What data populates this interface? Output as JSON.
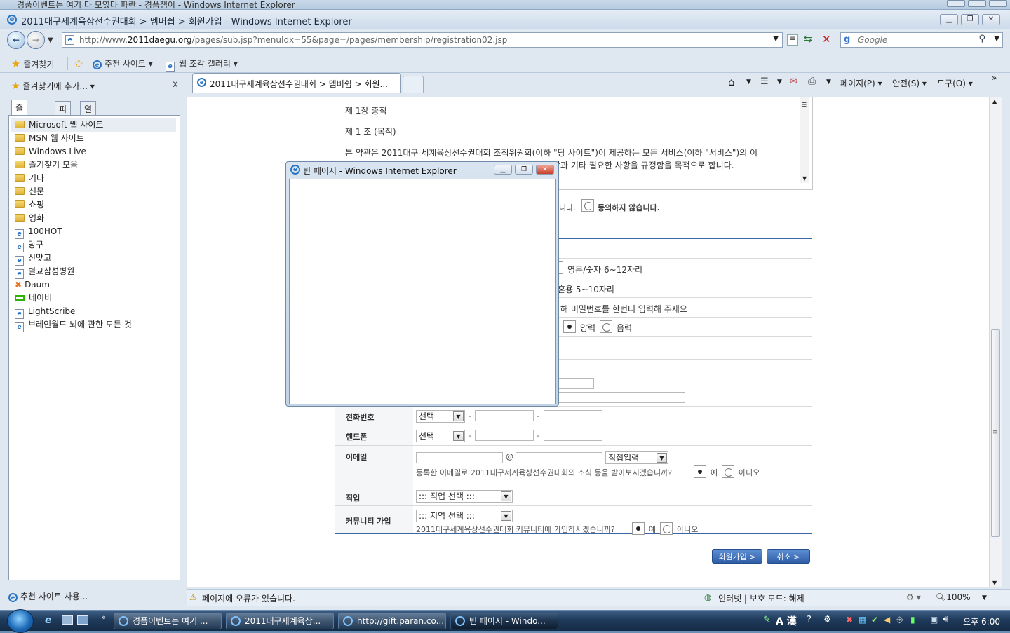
{
  "background_window": {
    "title": "경품이벤트는 여기 다 모였다 파란 - 경품잼이 - Windows Internet Explorer"
  },
  "window": {
    "title": "2011대구세계육상선수권대회 > 멤버쉽 > 회원가입 - Windows Internet Explorer",
    "address_prefix": "http://www.",
    "address_domain": "2011daegu.org",
    "address_path": "/pages/sub.jsp?menuIdx=55&page=/pages/membership/registration02.jsp",
    "search_placeholder": "Google"
  },
  "favorites_bar": {
    "favorites_label": "즐겨찾기",
    "suggested_sites": "추천 사이트",
    "web_slice_gallery": "웹 조각 갤러리"
  },
  "tab": {
    "title": "2011대구세계육상선수권대회 > 멤버쉽 > 회원..."
  },
  "command_bar": {
    "page": "페이지(P)",
    "safety": "안전(S)",
    "tools": "도구(O)",
    "chevron": "»"
  },
  "favorites_pane": {
    "add_label": "즐겨찾기에 추가...",
    "close": "x",
    "tabs": [
      "즐겨찾기",
      "피드",
      "열어본 페이지 목록"
    ],
    "items": [
      {
        "label": "Microsoft 웹 사이트",
        "kind": "folder"
      },
      {
        "label": "MSN 웹 사이트",
        "kind": "folder"
      },
      {
        "label": "Windows Live",
        "kind": "folder"
      },
      {
        "label": "즐겨찾기 모음",
        "kind": "folder"
      },
      {
        "label": "기타",
        "kind": "folder"
      },
      {
        "label": "신문",
        "kind": "folder"
      },
      {
        "label": "쇼핑",
        "kind": "folder"
      },
      {
        "label": "영화",
        "kind": "folder"
      },
      {
        "label": "100HOT",
        "kind": "page"
      },
      {
        "label": "당구",
        "kind": "page"
      },
      {
        "label": "신맞고",
        "kind": "page"
      },
      {
        "label": "별교삼성병원",
        "kind": "page"
      },
      {
        "label": "Daum",
        "kind": "daum"
      },
      {
        "label": "네이버",
        "kind": "naver"
      },
      {
        "label": "LightScribe",
        "kind": "page"
      },
      {
        "label": "브레인월드 뇌에 관한 모든 것",
        "kind": "page"
      }
    ],
    "footer": "추천 사이트 사용..."
  },
  "page": {
    "terms": {
      "chapter": "제 1장 총칙",
      "article": "제 1 조 (목적)",
      "line1": "본 약관은 2011대구 세계육상선수권대회 조직위원회(이하 \"당 사이트\")이 제공하는 모든 서비스(이하 \"서비스\")의 이",
      "line2": "항과 기타 필요한 사항을 규정함을 목적으로 합니다."
    },
    "agree_suffix": "니다.",
    "disagree_label": "동의하지 않습니다.",
    "hints": {
      "id": "영문/숫자 6~12자리",
      "password": "혼용 5~10자리",
      "password_confirm": "해 비밀번호를 한번더 입력해 주세요",
      "solar": "양력",
      "lunar": "음력"
    },
    "phone": {
      "label": "전화번호",
      "select": "선택",
      "dash": "-"
    },
    "mobile": {
      "label": "핸드폰",
      "select": "선택",
      "dash": "-"
    },
    "email": {
      "label": "이메일",
      "at": "@",
      "domain_select": "직접입력",
      "question": "등록한 이메일로 2011대구세계육상선수권대회의 소식 등을 받아보시겠습니까?",
      "yes": "예",
      "no": "아니오"
    },
    "job": {
      "label": "직업",
      "select": "::: 직업 선택 :::"
    },
    "community": {
      "label": "커뮤니티 가입",
      "select": "::: 지역 선택 :::",
      "question": "2011대구세계육상선수권대회 커뮤니티에 가입하시겠습니까?",
      "yes": "예",
      "no": "아니오"
    },
    "buttons": {
      "join": "회원가입 >",
      "cancel": "취소 >"
    }
  },
  "popup": {
    "title": "빈 페이지 - Windows Internet Explorer"
  },
  "status_bar": {
    "error": "페이지에 오류가 있습니다.",
    "zone": "인터넷 | 보호 모드: 해제",
    "zoom": "100%"
  },
  "taskbar": {
    "items": [
      "경품이벤트는 여기 ...",
      "2011대구세계육상...",
      "http://gift.paran.co...",
      "빈 페이지 - Windo..."
    ],
    "clock": "오후 6:00",
    "ime": "A 漢"
  }
}
